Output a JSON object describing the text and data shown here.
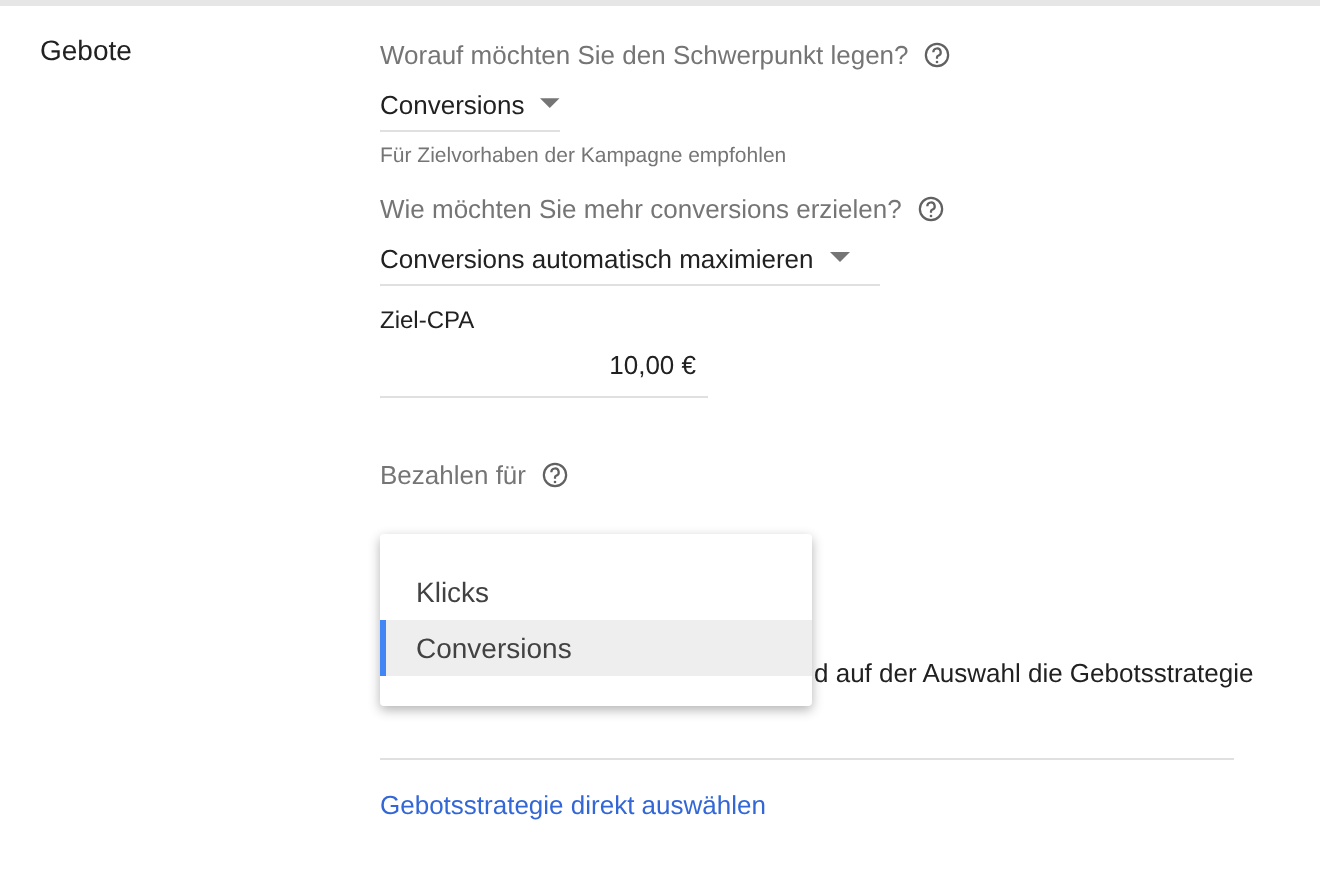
{
  "section_label": "Gebote",
  "focus": {
    "question": "Worauf möchten Sie den Schwerpunkt legen?",
    "value": "Conversions",
    "hint": "Für Zielvorhaben der Kampagne empfohlen"
  },
  "strategy": {
    "question": "Wie möchten Sie mehr conversions erzielen?",
    "value": "Conversions automatisch maximieren"
  },
  "target_cpa": {
    "label": "Ziel-CPA",
    "value": "10,00 €"
  },
  "pay_for": {
    "question": "Bezahlen für",
    "options": [
      {
        "label": "Klicks",
        "selected": false
      },
      {
        "label": "Conversions",
        "selected": true
      }
    ]
  },
  "hidden_note": "d auf der Auswahl die Gebotsstrategie",
  "link": "Gebotsstrategie direkt auswählen"
}
